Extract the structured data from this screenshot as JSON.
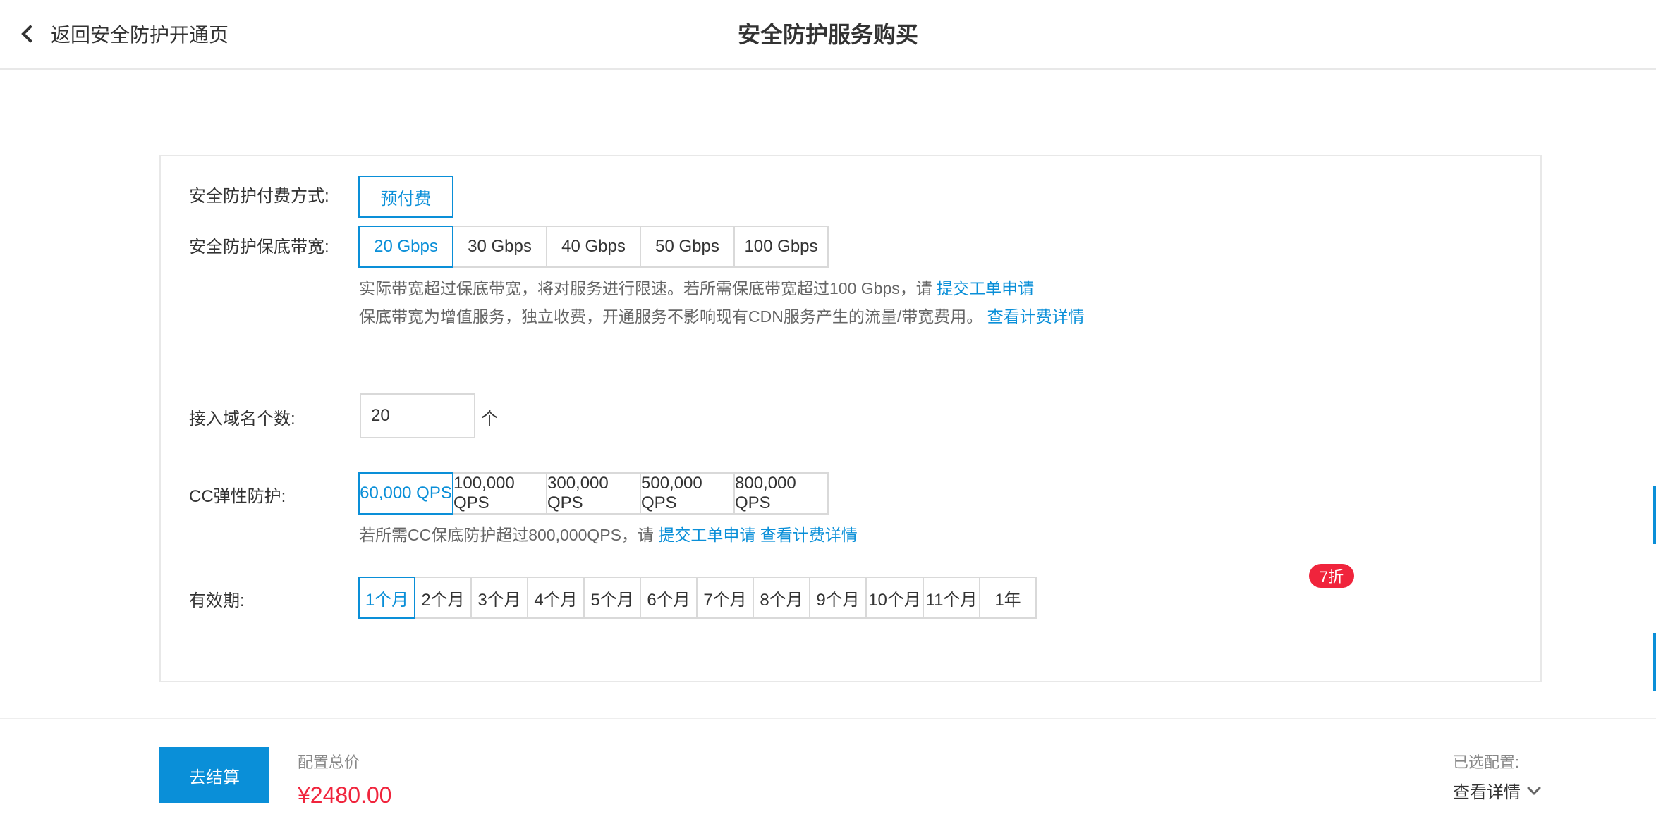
{
  "header": {
    "back_label": "返回安全防护开通页",
    "title": "安全防护服务购买"
  },
  "payment": {
    "label": "安全防护付费方式:",
    "options": [
      "预付费"
    ],
    "selected": "预付费"
  },
  "bandwidth": {
    "label": "安全防护保底带宽:",
    "options": [
      "20 Gbps",
      "30 Gbps",
      "40 Gbps",
      "50 Gbps",
      "100 Gbps"
    ],
    "selected": "20 Gbps",
    "note1_text": "实际带宽超过保底带宽，将对服务进行限速。若所需保底带宽超过100 Gbps，请 ",
    "note1_link": "提交工单申请",
    "note2_text": "保底带宽为增值服务，独立收费，开通服务不影响现有CDN服务产生的流量/带宽费用。 ",
    "note2_link": "查看计费详情"
  },
  "domains": {
    "label": "接入域名个数:",
    "value": "20",
    "unit": "个"
  },
  "cc": {
    "label": "CC弹性防护:",
    "options": [
      "60,000 QPS",
      "100,000 QPS",
      "300,000 QPS",
      "500,000 QPS",
      "800,000 QPS"
    ],
    "selected": "60,000 QPS",
    "note_text": "若所需CC保底防护超过800,000QPS，请 ",
    "note_link1": "提交工单申请",
    "note_link2": "查看计费详情"
  },
  "validity": {
    "label": "有效期:",
    "options": [
      "1个月",
      "2个月",
      "3个月",
      "4个月",
      "5个月",
      "6个月",
      "7个月",
      "8个月",
      "9个月",
      "10个月",
      "11个月",
      "1年"
    ],
    "selected": "1个月",
    "badge": "7折"
  },
  "footer": {
    "checkout_label": "去结算",
    "total_label": "配置总价",
    "total_price": "¥2480.00",
    "config_label": "已选配置:",
    "config_detail": "查看详情"
  },
  "colors": {
    "accent": "#0a8fd8",
    "price": "#f0243c",
    "badge": "#f0243c"
  }
}
